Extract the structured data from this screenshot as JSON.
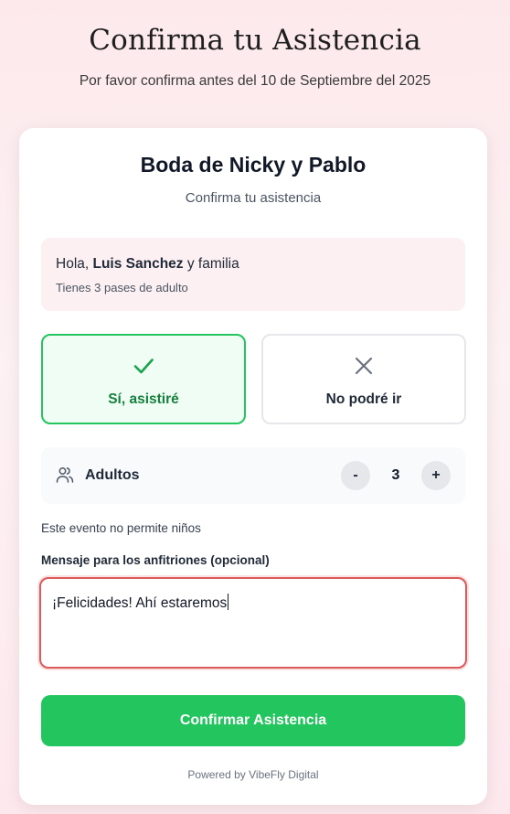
{
  "header": {
    "title": "Confirma tu Asistencia",
    "subtitle": "Por favor confirma antes del 10 de Septiembre del 2025"
  },
  "card": {
    "title": "Boda de Nicky y Pablo",
    "subtitle": "Confirma tu asistencia"
  },
  "guest": {
    "greeting": "Hola, ",
    "name": "Luis Sanchez",
    "suffix": " y familia",
    "passes": "Tienes 3 pases de adulto"
  },
  "attendance": {
    "yes_label": "Sí, asistiré",
    "no_label": "No podré ir",
    "selected": "yes"
  },
  "adults": {
    "label": "Adultos",
    "minus": "-",
    "plus": "+",
    "value": "3"
  },
  "notice": "Este evento no permite niños",
  "message": {
    "label": "Mensaje para los anfitriones (opcional)",
    "value": "¡Felicidades! Ahí estaremos"
  },
  "confirm_label": "Confirmar Asistencia",
  "powered_by": "Powered by VibeFly Digital",
  "colors": {
    "accent_green": "#22c55e",
    "focus_red": "#dc5a5a",
    "guest_bg": "#fdf0f2"
  }
}
